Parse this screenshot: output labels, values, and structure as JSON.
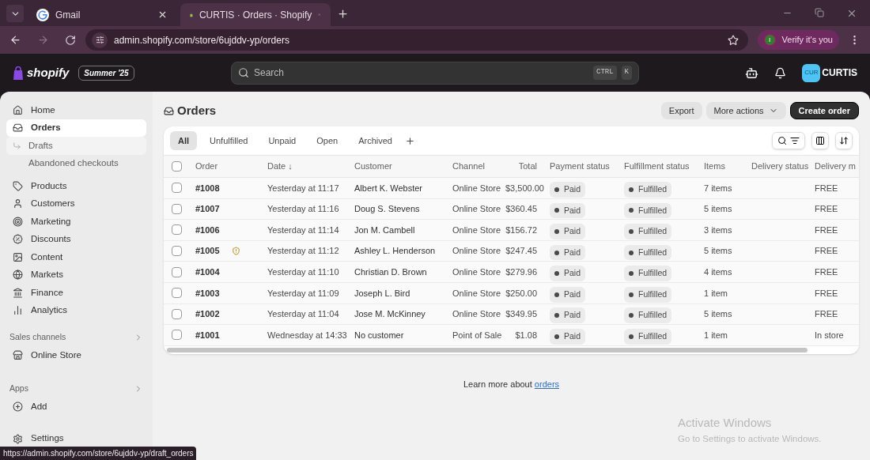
{
  "browser": {
    "tabs": [
      {
        "title": "Gmail",
        "kind": "google",
        "selected": false
      },
      {
        "title": "CURTIS · Orders · Shopify",
        "kind": "shopify",
        "selected": true
      }
    ],
    "url": "admin.shopify.com/store/6ujddv-yp/orders",
    "verify_label": "Verify it's you",
    "profile_initial": "I"
  },
  "topbar": {
    "logo": "shopify",
    "edition": "Summer '25",
    "search_placeholder": "Search",
    "shortcut_keys": [
      "CTRL",
      "K"
    ],
    "avatar": "CUR",
    "store": "CURTIS"
  },
  "sidebar": {
    "items": [
      {
        "label": "Home",
        "selected": false
      },
      {
        "label": "Orders",
        "selected": true,
        "children": [
          {
            "label": "Drafts",
            "hovered": true
          },
          {
            "label": "Abandoned checkouts",
            "hovered": false
          }
        ]
      },
      {
        "label": "Products",
        "selected": false
      },
      {
        "label": "Customers",
        "selected": false
      },
      {
        "label": "Marketing",
        "selected": false
      },
      {
        "label": "Discounts",
        "selected": false
      },
      {
        "label": "Content",
        "selected": false
      },
      {
        "label": "Markets",
        "selected": false
      },
      {
        "label": "Finance",
        "selected": false
      },
      {
        "label": "Analytics",
        "selected": false
      }
    ],
    "sections": [
      {
        "title": "Sales channels",
        "items": [
          "Online Store"
        ]
      },
      {
        "title": "Apps",
        "items": [
          "Add"
        ]
      }
    ],
    "settings": "Settings"
  },
  "page": {
    "title": "Orders",
    "all_checked": false,
    "actions": [
      {
        "label": "Export",
        "kind": "secondary"
      },
      {
        "label": "More actions",
        "kind": "menu"
      },
      {
        "label": "Create order",
        "kind": "primary"
      }
    ],
    "tabs": [
      {
        "label": "All",
        "selected": true
      },
      {
        "label": "Unfulfilled",
        "selected": false
      },
      {
        "label": "Unpaid",
        "selected": false
      },
      {
        "label": "Open",
        "selected": false
      },
      {
        "label": "Archived",
        "selected": false
      }
    ],
    "columns": [
      "Order",
      "Date ↓",
      "Customer",
      "Channel",
      "Total",
      "Payment status",
      "Fulfillment status",
      "Items",
      "Delivery status",
      "Delivery m"
    ],
    "rows": [
      {
        "checked": false,
        "order": "#1008",
        "alert": false,
        "date": "Yesterday at 11:17",
        "customer": "Albert K. Webster",
        "channel": "Online Store",
        "total": "$3,500.00",
        "payment": "Paid",
        "fulfillment": "Fulfilled",
        "items": "7 items",
        "delivery_method": "FREE"
      },
      {
        "checked": false,
        "order": "#1007",
        "alert": false,
        "date": "Yesterday at 11:16",
        "customer": "Doug S. Stevens",
        "channel": "Online Store",
        "total": "$360.45",
        "payment": "Paid",
        "fulfillment": "Fulfilled",
        "items": "5 items",
        "delivery_method": "FREE"
      },
      {
        "checked": false,
        "order": "#1006",
        "alert": false,
        "date": "Yesterday at 11:14",
        "customer": "Jon M. Cambell",
        "channel": "Online Store",
        "total": "$156.72",
        "payment": "Paid",
        "fulfillment": "Fulfilled",
        "items": "3 items",
        "delivery_method": "FREE"
      },
      {
        "checked": false,
        "order": "#1005",
        "alert": true,
        "date": "Yesterday at 11:12",
        "customer": "Ashley L. Henderson",
        "channel": "Online Store",
        "total": "$247.45",
        "payment": "Paid",
        "fulfillment": "Fulfilled",
        "items": "5 items",
        "delivery_method": "FREE"
      },
      {
        "checked": false,
        "order": "#1004",
        "alert": false,
        "date": "Yesterday at 11:10",
        "customer": "Christian D. Brown",
        "channel": "Online Store",
        "total": "$279.96",
        "payment": "Paid",
        "fulfillment": "Fulfilled",
        "items": "4 items",
        "delivery_method": "FREE"
      },
      {
        "checked": false,
        "order": "#1003",
        "alert": false,
        "date": "Yesterday at 11:09",
        "customer": "Joseph L. Bird",
        "channel": "Online Store",
        "total": "$250.00",
        "payment": "Paid",
        "fulfillment": "Fulfilled",
        "items": "1 item",
        "delivery_method": "FREE"
      },
      {
        "checked": false,
        "order": "#1002",
        "alert": false,
        "date": "Yesterday at 11:04",
        "customer": "Jose M. McKinney",
        "channel": "Online Store",
        "total": "$349.95",
        "payment": "Paid",
        "fulfillment": "Fulfilled",
        "items": "5 items",
        "delivery_method": "FREE"
      },
      {
        "checked": false,
        "order": "#1001",
        "alert": false,
        "date": "Wednesday at 14:33",
        "customer": "No customer",
        "channel": "Point of Sale",
        "total": "$1.08",
        "payment": "Paid",
        "fulfillment": "Fulfilled",
        "items": "1 item",
        "delivery_method": "In store"
      }
    ],
    "footer_text": "Learn more about",
    "footer_link": "orders"
  },
  "status_url": "https://admin.shopify.com/store/6ujddv-yp/draft_orders",
  "os_notice": {
    "title": "Activate Windows",
    "subtitle": "Go to Settings to activate Windows."
  }
}
